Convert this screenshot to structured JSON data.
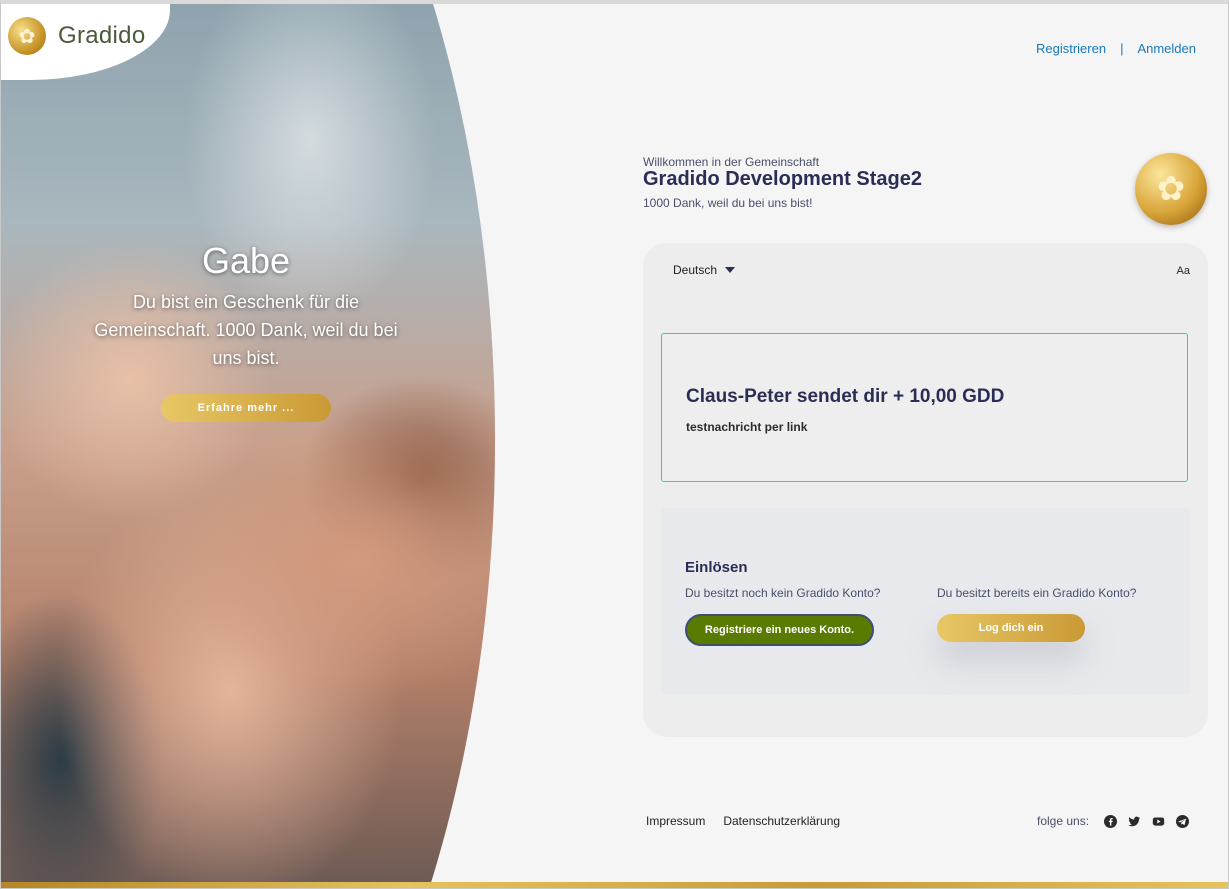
{
  "logo": {
    "text": "Gradido"
  },
  "hero": {
    "title": "Gabe",
    "text": "Du bist ein Geschenk für die Gemeinschaft. 1000 Dank, weil du bei uns bist.",
    "button": "Erfahre mehr ..."
  },
  "nav": {
    "register": "Registrieren",
    "separator": "|",
    "login": "Anmelden"
  },
  "welcome": {
    "small": "Willkommen in der Gemeinschaft",
    "title": "Gradido Development Stage2",
    "sub": "1000 Dank, weil du bei uns bist!"
  },
  "card": {
    "language": "Deutsch",
    "font_toggle": "Aa",
    "message_title": "Claus-Peter sendet dir + 10,00 GDD",
    "message_note": "testnachricht per link",
    "redeem_title": "Einlösen",
    "no_account_question": "Du besitzt noch kein Gradido Konto?",
    "has_account_question": "Du besitzt bereits ein Gradido Konto?",
    "register_button": "Registriere ein neues Konto.",
    "login_button": "Log dich ein"
  },
  "footer": {
    "impressum": "Impressum",
    "privacy": "Datenschutzerklärung",
    "follow": "folge uns:",
    "social_icons": [
      "facebook-icon",
      "twitter-icon",
      "youtube-icon",
      "telegram-icon"
    ]
  },
  "colors": {
    "accent_gold": "#c99a35",
    "navy": "#2a2e55",
    "green": "#5a7b02",
    "link": "#1a78b8",
    "cyan_border": "#3ec3dd"
  }
}
